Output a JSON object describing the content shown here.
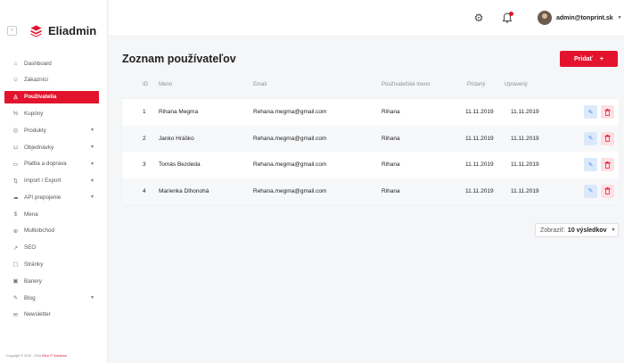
{
  "brand": {
    "name": "Eliadmin",
    "collapse_icon": "chevron-left-icon",
    "accent": "#e3132d"
  },
  "sidebar": {
    "items": [
      {
        "label": "Dashboard",
        "icon": "dashboard-icon",
        "glyph": "⌂",
        "caret": false,
        "active": false
      },
      {
        "label": "Zákazníci",
        "icon": "customers-icon",
        "glyph": "☺",
        "caret": false,
        "active": false
      },
      {
        "label": "Používatelia",
        "icon": "user-icon",
        "glyph": "♙",
        "caret": false,
        "active": true
      },
      {
        "label": "Kupóny",
        "icon": "percent-icon",
        "glyph": "%",
        "caret": false,
        "active": false
      },
      {
        "label": "Produkty",
        "icon": "box-icon",
        "glyph": "◎",
        "caret": true,
        "active": false
      },
      {
        "label": "Objednávky",
        "icon": "cart-icon",
        "glyph": "⊔",
        "caret": true,
        "active": false
      },
      {
        "label": "Platba a doprava",
        "icon": "card-icon",
        "glyph": "▭",
        "caret": true,
        "active": false
      },
      {
        "label": "Import / Export",
        "icon": "import-export-icon",
        "glyph": "⇅",
        "caret": true,
        "active": false
      },
      {
        "label": "API prepojenie",
        "icon": "cloud-icon",
        "glyph": "☁",
        "caret": true,
        "active": false
      },
      {
        "label": "Mena",
        "icon": "dollar-icon",
        "glyph": "$",
        "caret": false,
        "active": false
      },
      {
        "label": "Multiobchod",
        "icon": "globe-icon",
        "glyph": "⊕",
        "caret": false,
        "active": false
      },
      {
        "label": "SEO",
        "icon": "trend-icon",
        "glyph": "↗",
        "caret": false,
        "active": false
      },
      {
        "label": "Stránky",
        "icon": "page-icon",
        "glyph": "▢",
        "caret": false,
        "active": false
      },
      {
        "label": "Banery",
        "icon": "image-icon",
        "glyph": "▣",
        "caret": false,
        "active": false
      },
      {
        "label": "Blog",
        "icon": "pen-icon",
        "glyph": "✎",
        "caret": true,
        "active": false
      },
      {
        "label": "Newsletter",
        "icon": "mail-icon",
        "glyph": "✉",
        "caret": false,
        "active": false
      }
    ],
    "copyright_text": "Copyright © 2018 - 2026 ",
    "copyright_link": "Elixir IT Solutions"
  },
  "topbar": {
    "settings_icon": "gear-icon",
    "notifications_icon": "bell-icon",
    "user_name": "admin@tonprint.sk",
    "user_caret_icon": "chevron-down-icon"
  },
  "main": {
    "title": "Zoznam používateľov",
    "add_button": "Pridať",
    "add_icon": "+",
    "columns": [
      "ID",
      "Meno",
      "Email",
      "Používateľské meno",
      "Pridaný",
      "Upravený"
    ],
    "rows": [
      {
        "id": "1",
        "name": "Rihana Megma",
        "email": "Rehana.megma@gmail.com",
        "username": "Rihana",
        "added": "11.11.2019",
        "updated": "11.11.2019"
      },
      {
        "id": "2",
        "name": "Janko Hráško",
        "email": "Rehana.megma@gmail.com",
        "username": "Rihana",
        "added": "11.11.2019",
        "updated": "11.11.2019"
      },
      {
        "id": "3",
        "name": "Tomás Bezdeda",
        "email": "Rehana.megma@gmail.com",
        "username": "Rihana",
        "added": "11.11.2019",
        "updated": "11.11.2019"
      },
      {
        "id": "4",
        "name": "Marienka Dlhonohá",
        "email": "Rehana.megma@gmail.com",
        "username": "Rihana",
        "added": "11.11.2019",
        "updated": "11.11.2019"
      }
    ],
    "edit_icon": "pencil-icon",
    "delete_icon": "trash-icon",
    "pager_label": "Zobraziť:",
    "pager_value": "10 výsledkov"
  }
}
